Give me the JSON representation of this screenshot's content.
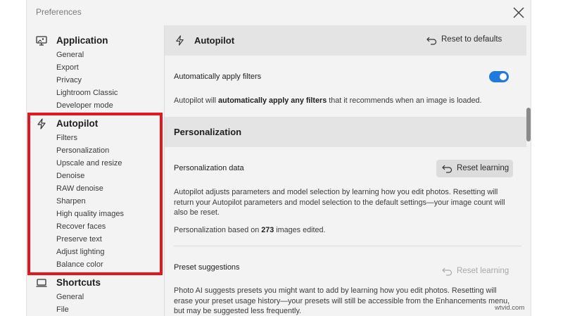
{
  "window": {
    "title": "Preferences"
  },
  "sidebar": {
    "groups": [
      {
        "label": "Application",
        "icon": "monitor-icon",
        "items": [
          "General",
          "Export",
          "Privacy",
          "Lightroom Classic",
          "Developer mode"
        ]
      },
      {
        "label": "Autopilot",
        "icon": "lightning-icon",
        "items": [
          "Filters",
          "Personalization",
          "Upscale and resize",
          "Denoise",
          "RAW denoise",
          "Sharpen",
          "High quality images",
          "Recover faces",
          "Preserve text",
          "Adjust lighting",
          "Balance color"
        ]
      },
      {
        "label": "Shortcuts",
        "icon": "laptop-icon",
        "items": [
          "General",
          "File"
        ]
      }
    ]
  },
  "main": {
    "autopilot": {
      "title": "Autopilot",
      "reset_label": "Reset to defaults",
      "auto_apply_label": "Automatically apply filters",
      "auto_apply_enabled": true,
      "desc_pre": "Autopilot will ",
      "desc_bold": "automatically apply any filters",
      "desc_post": " that it recommends when an image is loaded."
    },
    "personalization": {
      "title": "Personalization",
      "data_label": "Personalization data",
      "reset_learning_label": "Reset learning",
      "desc": "Autopilot adjusts parameters and model selection by learning how you edit photos. Resetting will return your Autopilot parameters and model selection to the default settings—your image count will also be reset.",
      "count_pre": "Personalization based on ",
      "count_value": "273",
      "count_post": " images edited.",
      "preset_label": "Preset suggestions",
      "preset_reset_label": "Reset learning",
      "preset_desc": "Photo AI suggests presets you might want to add by learning how you edit photos. Resetting will erase your preset usage history—your presets will still be accessible from the Enhancements menu, but may be suggested less frequently."
    }
  },
  "watermark": "wtvid.com",
  "colors": {
    "highlight": "#e3151f",
    "toggle_on": "#1f7ae0",
    "section_bg": "#e4e4e4"
  }
}
